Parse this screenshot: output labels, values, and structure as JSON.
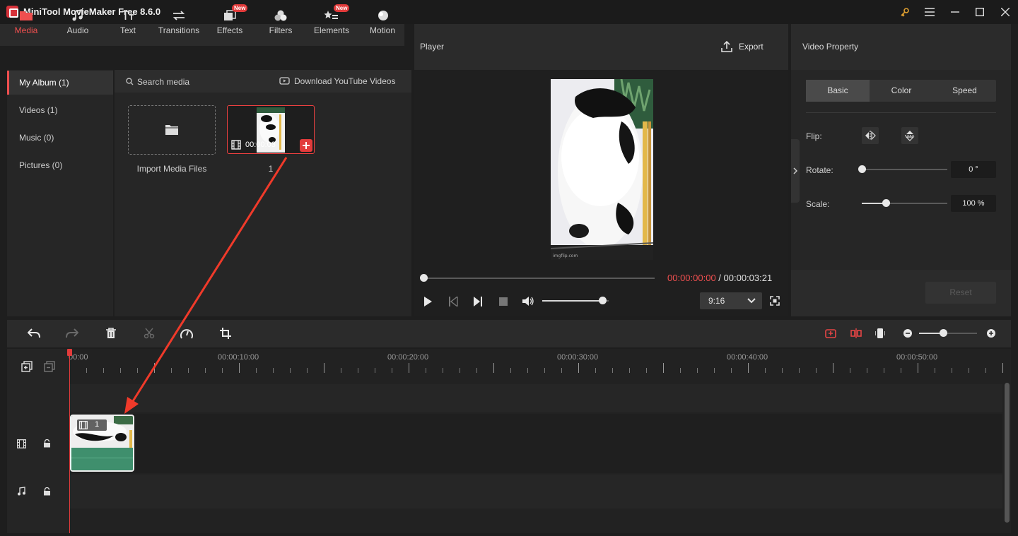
{
  "app": {
    "title": "MiniTool MovieMaker Free 8.6.0"
  },
  "tools": [
    {
      "label": "Media",
      "icon": "folder-icon",
      "active": true,
      "new": false
    },
    {
      "label": "Audio",
      "icon": "music-note-icon",
      "active": false,
      "new": false
    },
    {
      "label": "Text",
      "icon": "text-icon",
      "active": false,
      "new": false
    },
    {
      "label": "Transitions",
      "icon": "transitions-icon",
      "active": false,
      "new": false
    },
    {
      "label": "Effects",
      "icon": "effects-icon",
      "active": false,
      "new": true
    },
    {
      "label": "Filters",
      "icon": "filters-icon",
      "active": false,
      "new": false
    },
    {
      "label": "Elements",
      "icon": "elements-icon",
      "active": false,
      "new": true
    },
    {
      "label": "Motion",
      "icon": "motion-icon",
      "active": false,
      "new": false
    }
  ],
  "new_badge": "New",
  "album": [
    {
      "label": "My Album (1)",
      "active": true
    },
    {
      "label": "Videos (1)",
      "active": false
    },
    {
      "label": "Music (0)",
      "active": false
    },
    {
      "label": "Pictures (0)",
      "active": false
    }
  ],
  "media": {
    "search_placeholder": "Search media",
    "download_label": "Download YouTube Videos",
    "import_label": "Import Media Files",
    "clip_duration": "00:00:03",
    "clip_name": "1"
  },
  "player": {
    "title": "Player",
    "export_label": "Export",
    "current_time": "00:00:00:00",
    "separator": " / ",
    "total_time": "00:00:03:21",
    "aspect_ratio": "9:16",
    "watermark": "imgflip.com",
    "progress": 0,
    "volume": 0.9
  },
  "property": {
    "title": "Video Property",
    "tabs": [
      "Basic",
      "Color",
      "Speed"
    ],
    "active_tab": "Basic",
    "flip_label": "Flip:",
    "rotate_label": "Rotate:",
    "rotate_value": "0 °",
    "rotate_level": 0,
    "scale_label": "Scale:",
    "scale_value": "100 %",
    "scale_level": 0.28,
    "reset_label": "Reset"
  },
  "timeline": {
    "ruler_labels": [
      "00:00",
      "00:00:10:00",
      "00:00:20:00",
      "00:00:30:00",
      "00:00:40:00",
      "00:00:50:00"
    ],
    "clip_label": "1",
    "zoom_level": 0.42
  },
  "colors": {
    "accent": "#ef4f4f",
    "audio_strip": "#3f8f6d",
    "panel": "#2b2b2b"
  }
}
